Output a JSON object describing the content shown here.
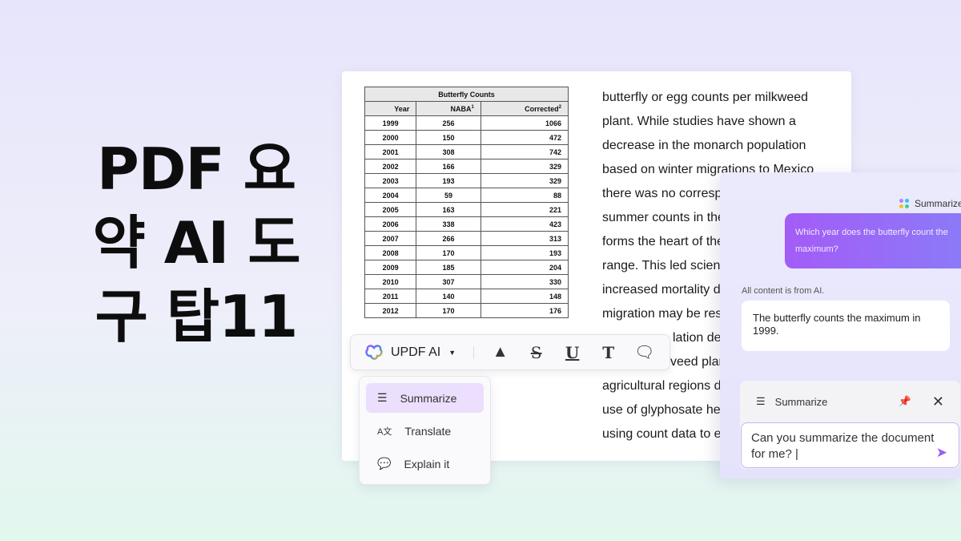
{
  "headline": {
    "lines": [
      "PDF 요",
      "약 AI 도",
      "구 탑11"
    ]
  },
  "table": {
    "caption": "Butterfly Counts",
    "headers": [
      "Year",
      "NABA",
      "Corrected"
    ],
    "header_sups": [
      "",
      "1",
      "2"
    ],
    "rows": [
      [
        "1999",
        "256",
        "1066"
      ],
      [
        "2000",
        "150",
        "472"
      ],
      [
        "2001",
        "308",
        "742"
      ],
      [
        "2002",
        "166",
        "329"
      ],
      [
        "2003",
        "193",
        "329"
      ],
      [
        "2004",
        "59",
        "88"
      ],
      [
        "2005",
        "163",
        "221"
      ],
      [
        "2006",
        "338",
        "423"
      ],
      [
        "2007",
        "266",
        "313"
      ],
      [
        "2008",
        "170",
        "193"
      ],
      [
        "2009",
        "185",
        "204"
      ],
      [
        "2010",
        "307",
        "330"
      ],
      [
        "2011",
        "140",
        "148"
      ],
      [
        "2012",
        "170",
        "176"
      ]
    ]
  },
  "document": {
    "lines": [
      "butterfly or egg counts per milkweed",
      "plant. While studies have shown a",
      "decrease in the monarch population",
      "based on winter migrations to Mexico",
      "there was no corresp",
      "summer counts in the",
      "forms the heart of the",
      "range. This led scien",
      "increased mortality d",
      "migration may be res",
      "lation de",
      "veed plan",
      "agricultural regions d",
      "use of glyphosate he",
      "using count data to e"
    ]
  },
  "toolbar": {
    "ai_label": "UPDF AI",
    "icons": [
      "highlighter-icon",
      "strikethrough-icon",
      "underline-icon",
      "text-icon",
      "comment-icon"
    ]
  },
  "menu": {
    "items": [
      {
        "label": "Summarize",
        "icon": "list-icon",
        "active": true
      },
      {
        "label": "Translate",
        "icon": "translate-icon"
      },
      {
        "label": "Explain it",
        "icon": "explain-icon"
      }
    ]
  },
  "chat": {
    "badge": "Summarize",
    "question": "Which year does the butterfly count the maximum?",
    "disclaimer": "All content is from AI.",
    "answer": "The butterfly counts the maximum in 1999.",
    "composer_mode": "Summarize",
    "input_value": "Can you summarize the document for me?"
  },
  "colors": {
    "accent": "#9b5cf6",
    "menu_active": "#ebdffd"
  }
}
